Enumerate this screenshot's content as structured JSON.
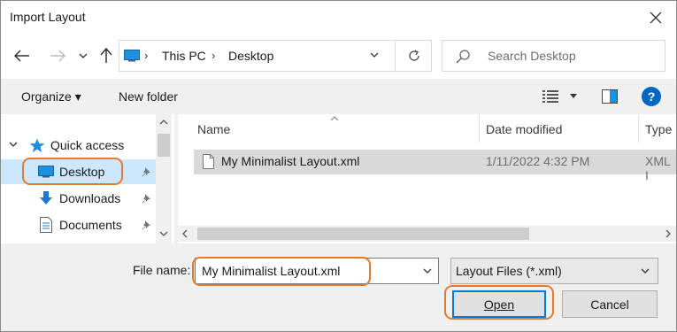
{
  "window": {
    "title": "Import Layout"
  },
  "nav": {
    "breadcrumb": [
      "This PC",
      "Desktop"
    ],
    "search_placeholder": "Search Desktop"
  },
  "toolbar": {
    "organize_label": "Organize ▾",
    "new_folder_label": "New folder",
    "help_label": "?"
  },
  "sidebar": {
    "items": [
      {
        "label": "Quick access",
        "icon": "star-icon"
      },
      {
        "label": "Desktop",
        "icon": "desktop-icon",
        "selected": true
      },
      {
        "label": "Downloads",
        "icon": "download-arrow-icon"
      },
      {
        "label": "Documents",
        "icon": "document-icon"
      }
    ]
  },
  "files": {
    "columns": [
      "Name",
      "Date modified",
      "Type"
    ],
    "rows": [
      {
        "name": "My Minimalist Layout.xml",
        "date": "1/11/2022 4:32 PM",
        "type": "XML I"
      }
    ]
  },
  "footer": {
    "file_name_label": "File name:",
    "file_name_value": "My Minimalist Layout.xml",
    "file_type_value": "Layout Files (*.xml)",
    "open_label": "Open",
    "cancel_label": "Cancel"
  },
  "colors": {
    "accent": "#0078d7",
    "highlight_ring": "#e8782a",
    "selection": "#d9d9d9"
  }
}
